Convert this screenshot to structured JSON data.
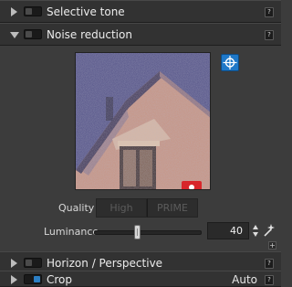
{
  "sections": {
    "selective_tone": {
      "label": "Selective tone",
      "help": "?"
    },
    "noise_reduction": {
      "label": "Noise reduction",
      "help": "?"
    },
    "horizon": {
      "label": "Horizon / Perspective",
      "help": "?"
    },
    "crop": {
      "label": "Crop",
      "value": "Auto",
      "help": "?"
    }
  },
  "noise": {
    "quality_label": "Quality",
    "quality_options": [
      "High",
      "PRIME"
    ],
    "luminance_label": "Luminance",
    "luminance_value": "40",
    "luminance_level": 0.4
  },
  "icons": {
    "picker": "crosshair-icon",
    "wand": "magic-wand-icon",
    "plus": "plus-icon"
  },
  "colors": {
    "accent": "#2c7fc4",
    "sky": "#4b4a82",
    "wall": "#c8907c"
  }
}
